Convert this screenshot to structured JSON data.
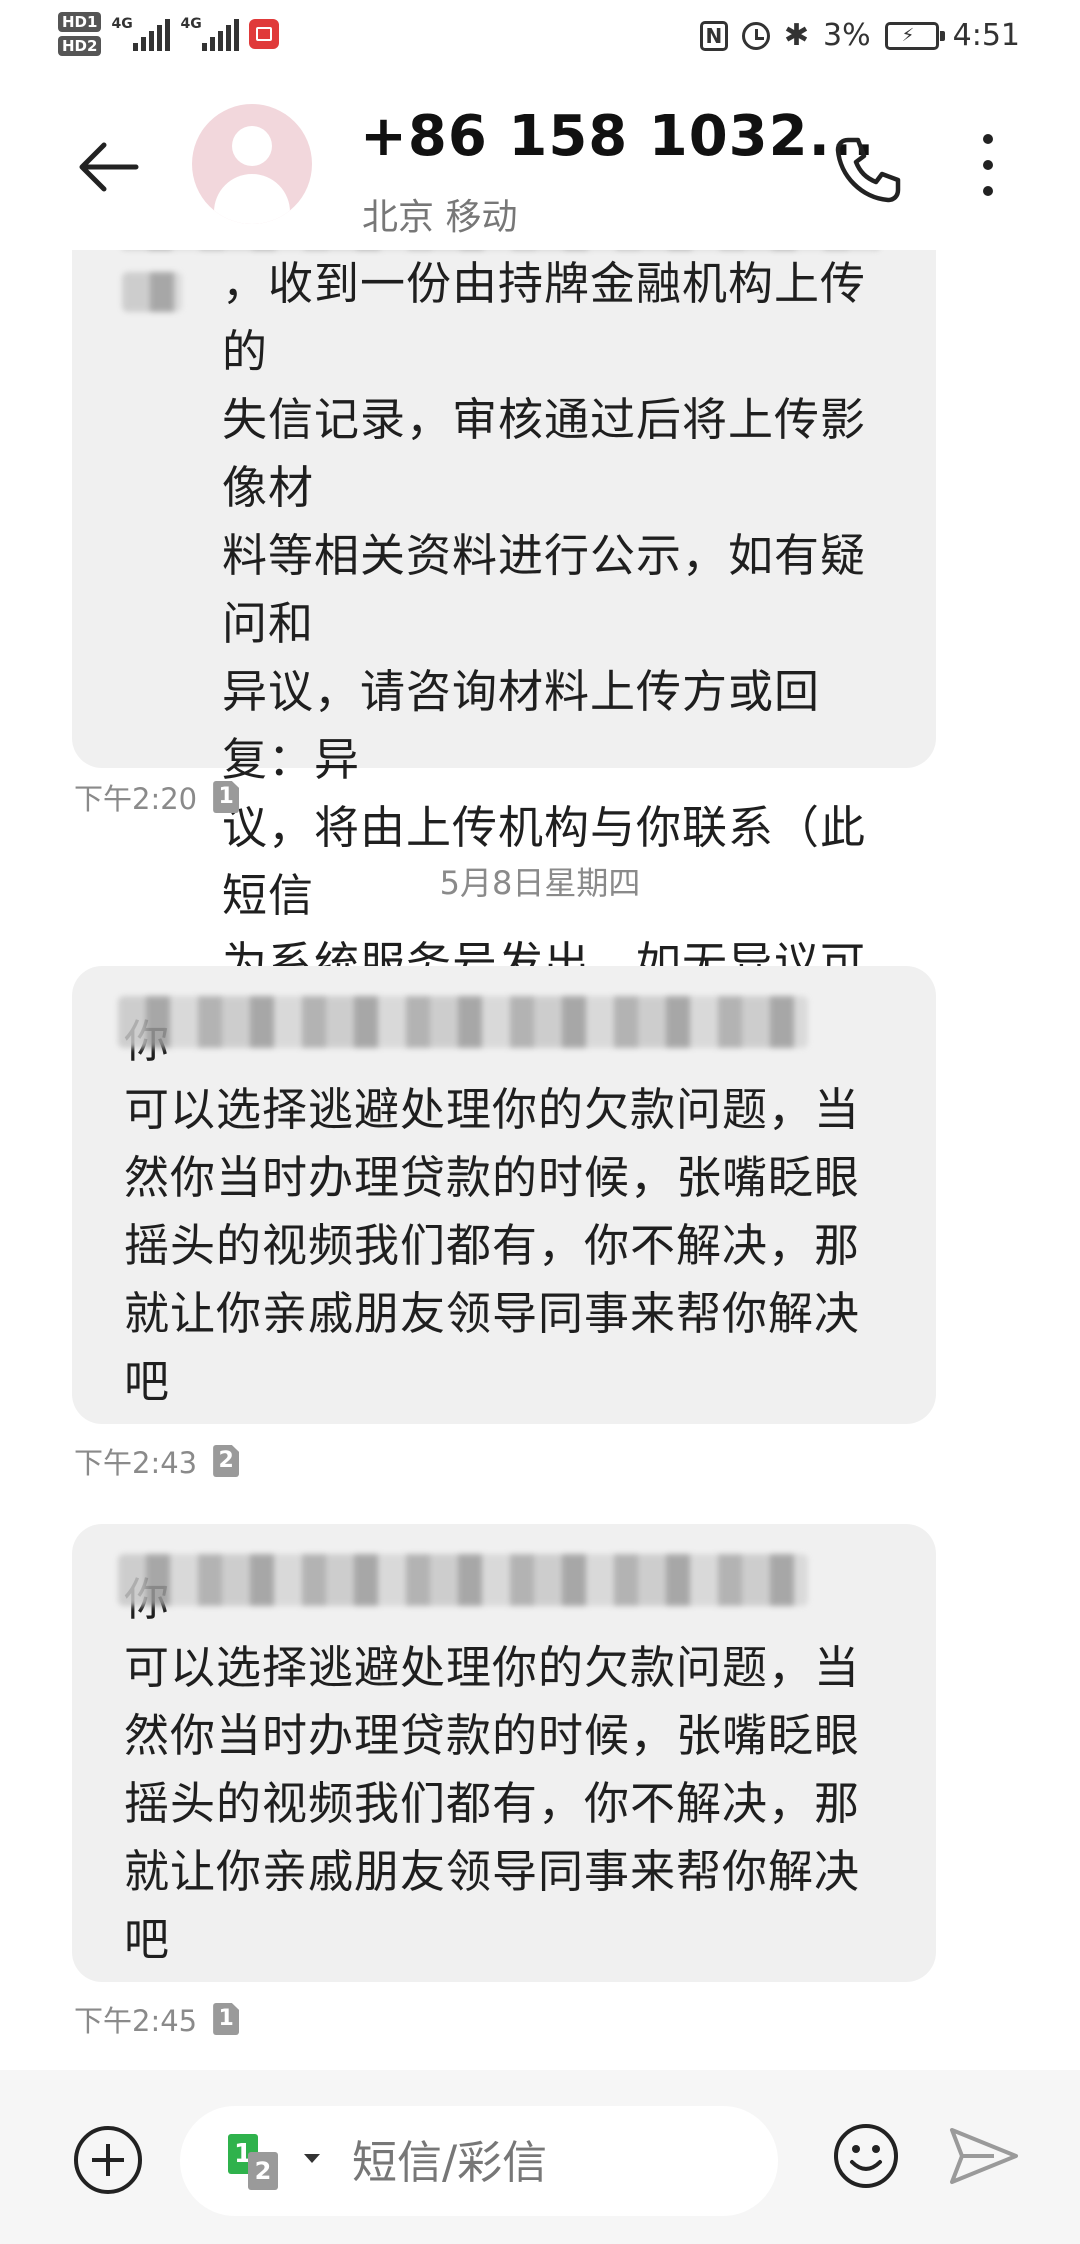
{
  "status_bar": {
    "hd1": "HD1",
    "hd2": "HD2",
    "net1": "4G",
    "net2": "4G",
    "battery": "3%",
    "time": "4:51"
  },
  "header": {
    "contact": "+86 158 1032...",
    "location": "北京 移动"
  },
  "messages": [
    {
      "text": "，收到一份由持牌金融机构上传的\n失信记录，审核通过后将上传影像材\n料等相关资料进行公示，如有疑问和\n异议，请咨询材料上传方或回复：异\n议，将由上传机构与你联系（此短信\n为系统服务号发出，如无异议可不用\n回复）",
      "time": "下午2:20",
      "sim": "1"
    },
    {
      "text": "你\n可以选择逃避处理你的欠款问题，当\n然你当时办理贷款的时候，张嘴眨眼\n摇头的视频我们都有，你不解决，那\n就让你亲戚朋友领导同事来帮你解决\n吧",
      "time": "下午2:43",
      "sim": "2"
    },
    {
      "text": "你\n可以选择逃避处理你的欠款问题，当\n然你当时办理贷款的时候，张嘴眨眼\n摇头的视频我们都有，你不解决，那\n就让你亲戚朋友领导同事来帮你解决\n吧",
      "time": "下午2:45",
      "sim": "1"
    }
  ],
  "date_separator": "5月8日星期四",
  "composer": {
    "placeholder": "短信/彩信",
    "sim_primary": "1",
    "sim_secondary": "2"
  },
  "colors": {
    "bubble": "#f0f0f0",
    "sim_active": "#2fb24c",
    "avatar_bg": "#f2d7dc"
  },
  "icons": [
    "back-arrow-icon",
    "avatar-icon",
    "phone-icon",
    "more-vertical-icon",
    "add-icon",
    "emoji-icon",
    "send-icon",
    "nfc-icon",
    "alarm-icon",
    "bluetooth-icon",
    "battery-icon"
  ]
}
